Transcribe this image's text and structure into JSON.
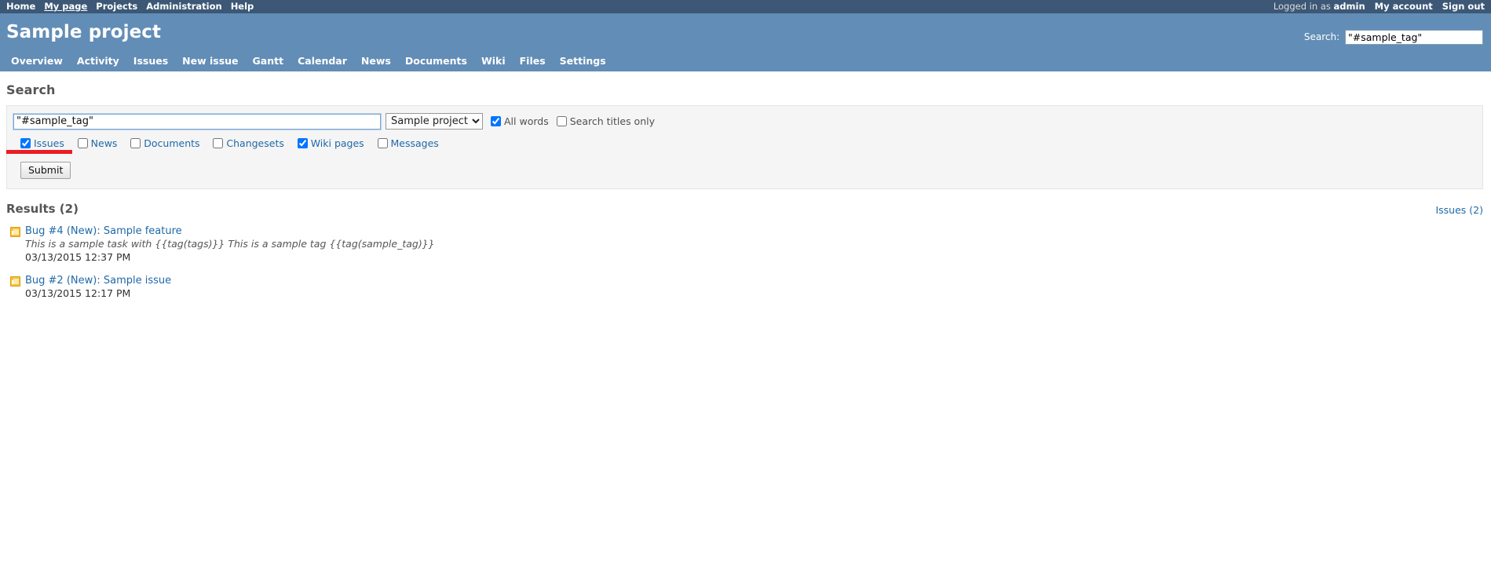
{
  "top_menu": {
    "left_links": [
      {
        "label": "Home",
        "selected": false
      },
      {
        "label": "My page",
        "selected": true
      },
      {
        "label": "Projects",
        "selected": false
      },
      {
        "label": "Administration",
        "selected": false
      },
      {
        "label": "Help",
        "selected": false
      }
    ],
    "logged_in_prefix": "Logged in as",
    "username": "admin",
    "my_account_label": "My account",
    "sign_out_label": "Sign out"
  },
  "header": {
    "project_title": "Sample project",
    "quick_search_label": "Search:",
    "quick_search_value": "\"#sample_tag\"",
    "quick_search_placeholder": ""
  },
  "main_menu": {
    "items": [
      {
        "label": "Overview"
      },
      {
        "label": "Activity"
      },
      {
        "label": "Issues"
      },
      {
        "label": "New issue"
      },
      {
        "label": "Gantt"
      },
      {
        "label": "Calendar"
      },
      {
        "label": "News"
      },
      {
        "label": "Documents"
      },
      {
        "label": "Wiki"
      },
      {
        "label": "Files"
      },
      {
        "label": "Settings"
      }
    ]
  },
  "page": {
    "title": "Search"
  },
  "search_form": {
    "query_value": "\"#sample_tag\"",
    "query_placeholder": "",
    "scope_selected": "Sample project",
    "scope_options": [
      "Sample project"
    ],
    "all_words_label": "All words",
    "all_words_checked": true,
    "titles_only_label": "Search titles only",
    "titles_only_checked": false,
    "object_types": [
      {
        "label": "Issues",
        "checked": true
      },
      {
        "label": "News",
        "checked": false
      },
      {
        "label": "Documents",
        "checked": false
      },
      {
        "label": "Changesets",
        "checked": false
      },
      {
        "label": "Wiki pages",
        "checked": true
      },
      {
        "label": "Messages",
        "checked": false
      }
    ],
    "submit_label": "Submit"
  },
  "results": {
    "heading": "Results (2)",
    "count": 2,
    "tab_label": "Issues (2)",
    "items": [
      {
        "icon": "issue-icon",
        "title": "Bug #4 (New): Sample feature",
        "description": "This is a sample task with {{tag(tags)}} This is a sample tag {{tag(sample_tag)}}",
        "date": "03/13/2015 12:37 PM"
      },
      {
        "icon": "issue-icon",
        "title": "Bug #2 (New): Sample issue",
        "description": "",
        "date": "03/13/2015 12:17 PM"
      }
    ]
  },
  "annotation": {
    "underline_color": "#ec1c24"
  },
  "colors": {
    "top_menu_bg": "#3c5876",
    "header_bg": "#628db6",
    "link": "#1f69a8",
    "panel_bg": "#f5f5f5",
    "issue_icon": "#f5c13a"
  }
}
